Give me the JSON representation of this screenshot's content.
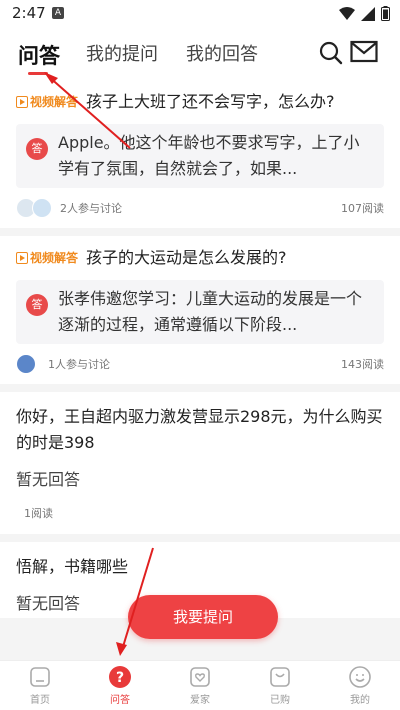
{
  "status_bar": {
    "time": "2:47",
    "notif_icon": "A"
  },
  "tabs": [
    {
      "label": "问答",
      "active": true
    },
    {
      "label": "我的提问",
      "active": false
    },
    {
      "label": "我的回答",
      "active": false
    }
  ],
  "feed": [
    {
      "badge": "视频解答",
      "question": "孩子上大班了还不会写字，怎么办?",
      "answer_mark": "答",
      "answer": "Apple。他这个年龄也不要求写字，上了小学有了氛围，自然就会了，如果...",
      "participants": "2人参与讨论",
      "reads": "107阅读"
    },
    {
      "badge": "视频解答",
      "question": "孩子的大运动是怎么发展的?",
      "answer_mark": "答",
      "answer": "张孝伟邀您学习：儿童大运动的发展是一个逐渐的过程，通常遵循以下阶段...",
      "participants": "1人参与讨论",
      "reads": "143阅读"
    },
    {
      "question": "你好，王自超内驱力激发营显示298元，为什么购买的时是398",
      "status": "暂无回答",
      "reads": "1阅读"
    },
    {
      "question": "悟解，书籍哪些",
      "status": "暂无回答"
    }
  ],
  "ask_button": "我要提问",
  "bottom_nav": [
    {
      "label": "首页",
      "icon": "home-icon"
    },
    {
      "label": "问答",
      "icon": "question-icon"
    },
    {
      "label": "爱家",
      "icon": "heart-icon"
    },
    {
      "label": "已购",
      "icon": "bag-icon"
    },
    {
      "label": "我的",
      "icon": "smile-icon"
    }
  ],
  "colors": {
    "accent": "#e83a3a",
    "badge": "#f08a1e"
  }
}
